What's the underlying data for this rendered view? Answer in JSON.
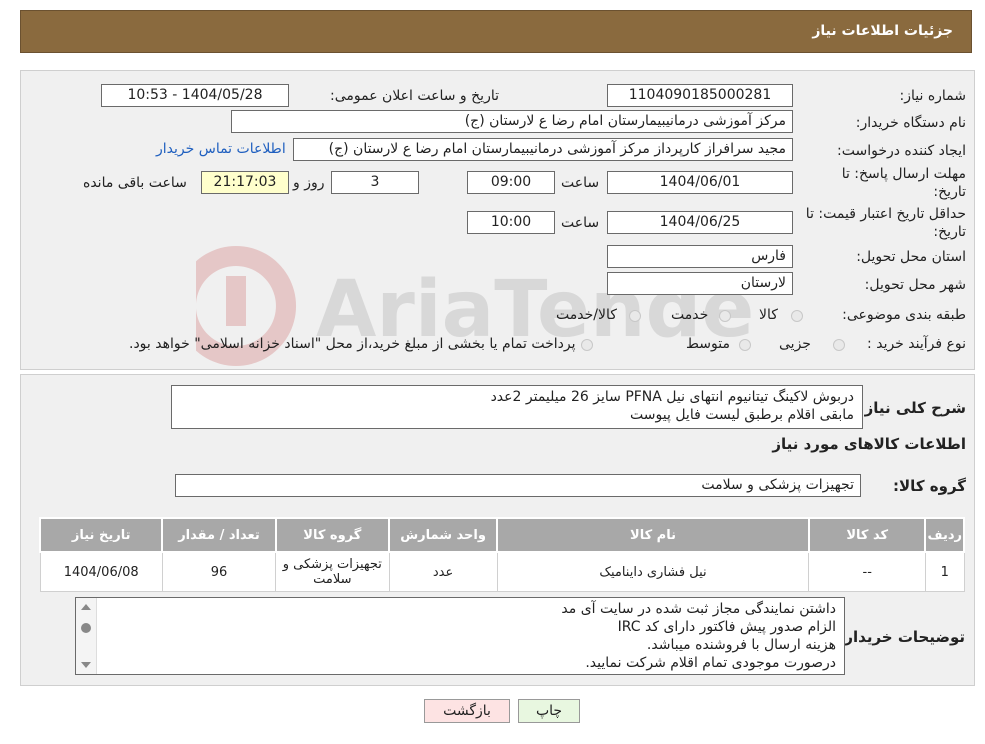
{
  "header": {
    "title": "جزئیات اطلاعات نیاز"
  },
  "form": {
    "need_number_label": "شماره نیاز:",
    "need_number": "1104090185000281",
    "announce_label": "تاریخ و ساعت اعلان عمومی:",
    "announce_value": "1404/05/28 - 10:53",
    "buyer_org_label": "نام دستگاه خریدار:",
    "buyer_org": "مرکز آموزشی درمانیبیمارستان امام رضا  ع  لارستان (ج)",
    "creator_label": "ایجاد کننده درخواست:",
    "creator": "مجید سرافراز کارپرداز  مرکز آموزشی درمانیبیمارستان امام رضا  ع  لارستان (ج)",
    "contact_link": "اطلاعات تماس خریدار",
    "deadline_label_1": "مهلت ارسال پاسخ: تا",
    "deadline_label_2": "تاریخ:",
    "deadline_date": "1404/06/01",
    "time_label": "ساعت",
    "deadline_time": "09:00",
    "days_value": "3",
    "days_label": "روز و",
    "remaining_value": "21:17:03",
    "remaining_label": "ساعت باقی مانده",
    "validity_label_1": "حداقل تاریخ اعتبار قیمت: تا",
    "validity_label_2": "تاریخ:",
    "validity_date": "1404/06/25",
    "validity_time": "10:00",
    "province_label": "استان محل تحویل:",
    "province": "فارس",
    "city_label": "شهر محل تحویل:",
    "city": "لارستان",
    "category_label": "طبقه بندی موضوعی:",
    "category_options": [
      "کالا",
      "خدمت",
      "کالا/خدمت"
    ],
    "process_label": "نوع فرآیند خرید :",
    "process_options": [
      "جزیی",
      "متوسط"
    ],
    "process_note": "پرداخت تمام یا بخشی از مبلغ خرید،از محل \"اسناد خزانه اسلامی\" خواهد بود."
  },
  "watermark": {
    "text": "AriaTender.neT"
  },
  "description": {
    "label": "شرح کلی نیاز:",
    "line1": "دربوش لاکینگ تیتانیوم انتهای نیل PFNA سایز 26 میلیمتر      2عدد",
    "line2": "مابقی اقلام برطبق لیست فایل پیوست"
  },
  "goods": {
    "section_title": "اطلاعات کالاهای مورد نیاز",
    "group_label": "گروه کالا:",
    "group_value": "تجهیزات پزشکی و سلامت",
    "columns": [
      "ردیف",
      "کد کالا",
      "نام کالا",
      "واحد شمارش",
      "گروه کالا",
      "تعداد / مقدار",
      "تاریخ نیاز"
    ],
    "rows": [
      [
        "1",
        "--",
        "نیل فشاری داینامیک",
        "عدد",
        "تجهیزات پزشکی و سلامت",
        "96",
        "1404/06/08"
      ]
    ]
  },
  "buyer_notes": {
    "label": "توضیحات خریدار:",
    "lines": [
      "داشتن نمایندگی مجاز ثبت شده در سایت آی مد",
      "الزام صدور پیش فاکتور دارای کد IRC",
      "هزینه ارسال با فروشنده میباشد.",
      "درصورت موجودی تمام اقلام شرکت نمایید."
    ]
  },
  "buttons": {
    "print": "چاپ",
    "back": "بازگشت"
  },
  "colors": {
    "header_bg": "#8a6a3e",
    "print_bg": "#e8f7e0",
    "back_bg": "#fde3e3"
  }
}
